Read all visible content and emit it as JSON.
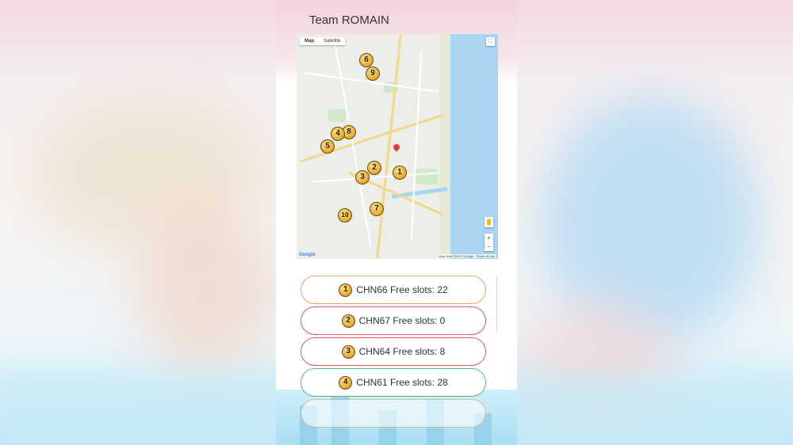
{
  "page": {
    "title": "Team ROMAIN"
  },
  "map": {
    "tabs": [
      {
        "label": "Map",
        "active": true
      },
      {
        "label": "Satellite",
        "active": false
      }
    ],
    "zoom_in": "+",
    "zoom_out": "−",
    "markers": [
      "1",
      "2",
      "3",
      "4",
      "5",
      "6",
      "7",
      "8",
      "9",
      "10"
    ]
  },
  "slots": [
    {
      "num": "1",
      "label": "CHN66 Free slots: 22",
      "border_color": "#e8a26b"
    },
    {
      "num": "2",
      "label": "CHN67 Free slots: 0",
      "border_color": "#d65c57"
    },
    {
      "num": "3",
      "label": "CHN64 Free slots: 8",
      "border_color": "#d65c57"
    },
    {
      "num": "4",
      "label": "CHN61 Free slots: 28",
      "border_color": "#4fbf7c"
    }
  ],
  "colors": {
    "marker_fill": "#e3a72d",
    "accent_pink": "#f3d3dd",
    "accent_blue": "#a9def3"
  }
}
